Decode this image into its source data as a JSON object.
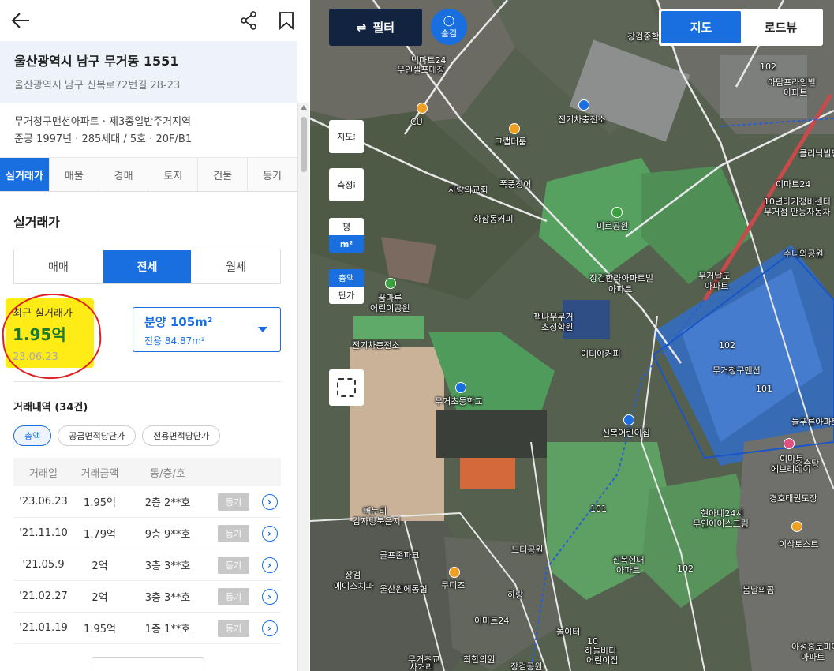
{
  "header": {
    "back_icon": "arrow-left-icon",
    "share_icon": "share-icon",
    "bookmark_icon": "bookmark-icon"
  },
  "address": {
    "jibun": "울산광역시 남구 무거동 1551",
    "road": "울산광역시 남구 신복로72번길 28-23"
  },
  "info": {
    "line1": "무거청구맨션아파트 · 제3종일반주거지역",
    "line2": "준공 1997년 · 285세대 / 5호 · 20F/B1"
  },
  "tabs": [
    "실거래가",
    "매물",
    "경매",
    "토지",
    "건물",
    "등기"
  ],
  "section_title": "실거래가",
  "deal_types": [
    "매매",
    "전세",
    "월세"
  ],
  "recent": {
    "label": "최근 실거래가",
    "price": "1.95억",
    "date": "23.06.23"
  },
  "size": {
    "title": "분양 105m²",
    "sub": "전용 84.87m²"
  },
  "history": {
    "title": "거래내역 (34건)",
    "chips": [
      "총액",
      "공급면적당단가",
      "전용면적당단가"
    ],
    "headers": [
      "거래일",
      "거래금액",
      "동/층/호"
    ],
    "register_label": "등기",
    "rows": [
      {
        "date": "'23.06.23",
        "price": "1.95억",
        "unit": "2층 2**호"
      },
      {
        "date": "'21.11.10",
        "price": "1.79억",
        "unit": "9층 9**호"
      },
      {
        "date": "'21.05.9",
        "price": "2억",
        "unit": "3층 3**호"
      },
      {
        "date": "'21.02.27",
        "price": "2억",
        "unit": "3층 3**호"
      },
      {
        "date": "'21.01.19",
        "price": "1.95억",
        "unit": "1층 1**호"
      }
    ]
  },
  "map": {
    "filter_label": "필터",
    "hide_label": "숨김",
    "view_toggle": [
      "지도",
      "로드뷰"
    ],
    "tools": {
      "map": "지도",
      "measure": "측정",
      "unit_py": "평",
      "unit_m2": "m²",
      "total": "총액",
      "unit_price": "단가"
    },
    "labels": [
      "빅마트24",
      "무인셀프매장",
      "CU",
      "장검중학교",
      "102",
      "아담프라임빌",
      "아파트",
      "전기차충전소",
      "그랩더룸",
      "폭풍장어",
      "사랑의교회",
      "하삼동커피",
      "미르공원",
      "클리닉빌딩",
      "이마트24",
      "10년타기정비센터",
      "무거점 만능자동차",
      "수니와공원",
      "장검한라아파트빌",
      "아파트",
      "무거날도",
      "아파트",
      "꿈마루",
      "어린이공원",
      "책나무무거",
      "초정학원",
      "이디야커피",
      "전기차충전소",
      "무거초등학교",
      "무거청구맨션",
      "102",
      "101",
      "늘푸른아파트",
      "신복어린이집",
      "이마트",
      "에브리데이",
      "청송탕",
      "경호태권도장",
      "101",
      "현아네24시",
      "무인아이스크림",
      "빼누리",
      "감자탕북은지",
      "골프존파크",
      "느티공원",
      "신복현대",
      "아파트",
      "이삭토스트",
      "102",
      "장검",
      "에이스치과",
      "쿠디즈",
      "하랑",
      "봄날의곰",
      "울산원에동협",
      "이마트24",
      "놀이터",
      "10",
      "하늘바다",
      "어린이집",
      "무거초교",
      "최한의원",
      "장검공원",
      "아성홈토피아",
      "아파트",
      "사거리"
    ]
  },
  "colors": {
    "accent": "#1a6fe0",
    "highlight": "#ffeb16",
    "price": "#1e7a2a",
    "circle": "#e02020",
    "filter_bg": "#12233f"
  }
}
